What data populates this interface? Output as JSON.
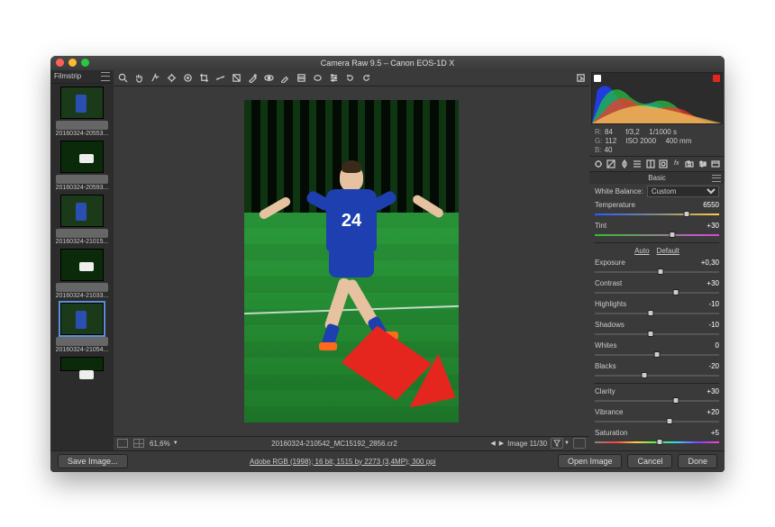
{
  "title": "Camera Raw 9.5  –  Canon EOS-1D X",
  "filmstrip": {
    "header": "Filmstrip",
    "items": [
      {
        "label": "20160324-20553..."
      },
      {
        "label": "20160324-20593..."
      },
      {
        "label": "20160324-21015..."
      },
      {
        "label": "20160324-21033..."
      },
      {
        "label": "20160324-21054..."
      }
    ]
  },
  "jersey": "24",
  "zoom": "61,6%",
  "filename": "20160324-210542_MC15192_2856.cr2",
  "counter": "Image 11/30",
  "readout": {
    "R": "84",
    "G": "112",
    "B": "40",
    "aperture": "f/3,2",
    "shutter": "1/1000 s",
    "iso": "ISO 2000",
    "focal": "400 mm"
  },
  "panel_title": "Basic",
  "wb_label": "White Balance:",
  "wb_value": "Custom",
  "auto": "Auto",
  "default": "Default",
  "sliders": {
    "temperature": {
      "label": "Temperature",
      "value": "6550",
      "pos": 74
    },
    "tint": {
      "label": "Tint",
      "value": "+30",
      "pos": 62
    },
    "exposure": {
      "label": "Exposure",
      "value": "+0,30",
      "pos": 53
    },
    "contrast": {
      "label": "Contrast",
      "value": "+30",
      "pos": 65
    },
    "highlights": {
      "label": "Highlights",
      "value": "-10",
      "pos": 45
    },
    "shadows": {
      "label": "Shadows",
      "value": "-10",
      "pos": 45
    },
    "whites": {
      "label": "Whites",
      "value": "0",
      "pos": 50
    },
    "blacks": {
      "label": "Blacks",
      "value": "-20",
      "pos": 40
    },
    "clarity": {
      "label": "Clarity",
      "value": "+30",
      "pos": 65
    },
    "vibrance": {
      "label": "Vibrance",
      "value": "+20",
      "pos": 60
    },
    "saturation": {
      "label": "Saturation",
      "value": "+5",
      "pos": 52
    }
  },
  "footer": {
    "save": "Save Image...",
    "profile": "Adobe RGB (1998); 16 bit; 1515 by 2273 (3,4MP); 300 ppi",
    "open": "Open Image",
    "cancel": "Cancel",
    "done": "Done"
  }
}
